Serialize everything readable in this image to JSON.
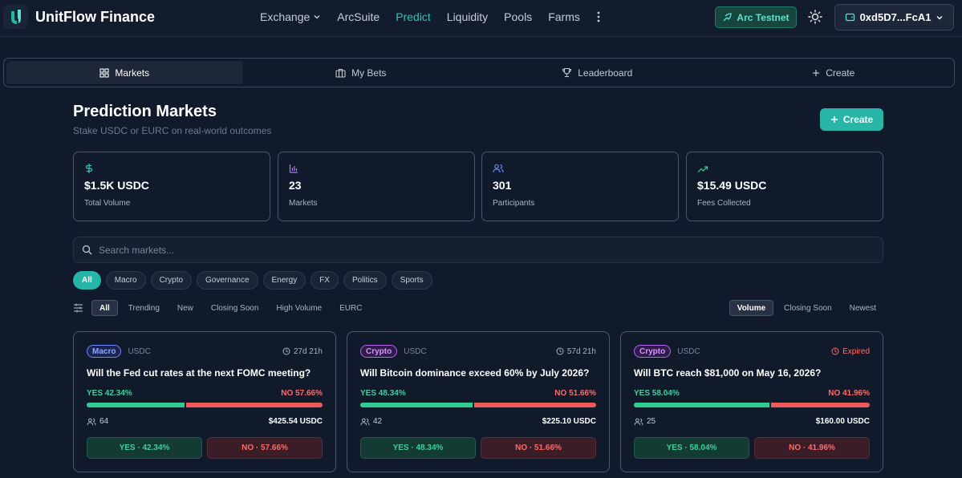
{
  "brand": {
    "name": "UnitFlow Finance"
  },
  "nav": {
    "items": [
      {
        "label": "Exchange",
        "has_dropdown": true
      },
      {
        "label": "ArcSuite"
      },
      {
        "label": "Predict",
        "active": true
      },
      {
        "label": "Liquidity"
      },
      {
        "label": "Pools"
      },
      {
        "label": "Farms"
      }
    ],
    "more_icon": "vertical-dots-icon"
  },
  "network": {
    "label": "Arc Testnet"
  },
  "wallet": {
    "address": "0xd5D7...FcA1"
  },
  "tabs": [
    {
      "label": "Markets",
      "icon": "grid-icon",
      "active": true
    },
    {
      "label": "My Bets",
      "icon": "briefcase-icon"
    },
    {
      "label": "Leaderboard",
      "icon": "trophy-icon"
    },
    {
      "label": "Create",
      "icon": "plus-icon"
    }
  ],
  "header": {
    "title": "Prediction Markets",
    "subtitle": "Stake USDC or EURC on real-world outcomes",
    "create_label": "Create"
  },
  "stats": [
    {
      "value": "$1.5K USDC",
      "label": "Total Volume",
      "icon": "dollar-icon"
    },
    {
      "value": "23",
      "label": "Markets",
      "icon": "bar-chart-icon"
    },
    {
      "value": "301",
      "label": "Participants",
      "icon": "users-icon"
    },
    {
      "value": "$15.49 USDC",
      "label": "Fees Collected",
      "icon": "trend-up-icon"
    }
  ],
  "search": {
    "placeholder": "Search markets..."
  },
  "categories": [
    "All",
    "Macro",
    "Crypto",
    "Governance",
    "Energy",
    "FX",
    "Politics",
    "Sports"
  ],
  "filters": [
    "All",
    "Trending",
    "New",
    "Closing Soon",
    "High Volume",
    "EURC"
  ],
  "sorts": [
    "Volume",
    "Closing Soon",
    "Newest"
  ],
  "markets": [
    {
      "category": "Macro",
      "currency": "USDC",
      "time": "27d 21h",
      "question": "Will the Fed cut rates at the next FOMC meeting?",
      "yes_label": "YES 42.34%",
      "no_label": "NO 57.66%",
      "yes_pct": 42.34,
      "participants": "64",
      "volume": "$425.54 USDC",
      "yes_btn": "YES · 42.34%",
      "no_btn": "NO · 57.66%"
    },
    {
      "category": "Crypto",
      "currency": "USDC",
      "time": "57d 21h",
      "question": "Will Bitcoin dominance exceed 60% by July 2026?",
      "yes_label": "YES 48.34%",
      "no_label": "NO 51.66%",
      "yes_pct": 48.34,
      "participants": "42",
      "volume": "$225.10 USDC",
      "yes_btn": "YES · 48.34%",
      "no_btn": "NO · 51.66%"
    },
    {
      "category": "Crypto",
      "currency": "USDC",
      "time": "Expired",
      "question": "Will BTC reach $81,000 on May 16, 2026?",
      "yes_label": "YES 58.04%",
      "no_label": "NO 41.96%",
      "yes_pct": 58.04,
      "participants": "25",
      "volume": "$160.00 USDC",
      "yes_btn": "YES · 58.04%",
      "no_btn": "NO · 41.96%"
    }
  ],
  "colors": {
    "accent": "#26b5a6",
    "yes": "#2ecc8f",
    "no": "#ee5a5a",
    "background": "#111a2b"
  }
}
